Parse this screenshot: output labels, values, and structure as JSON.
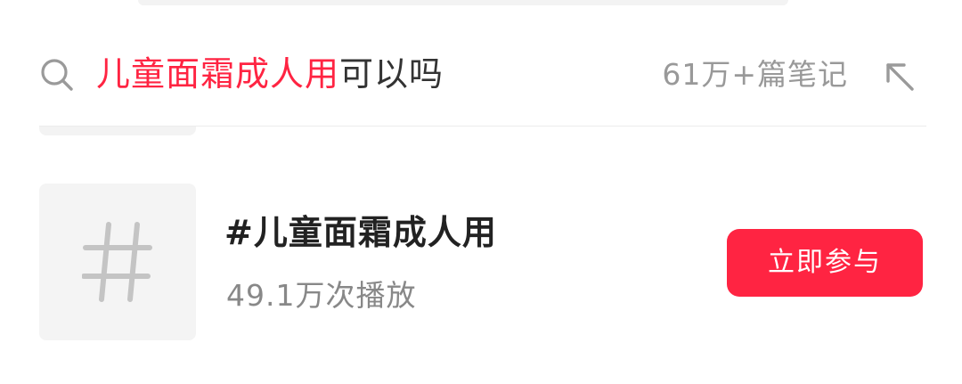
{
  "suggestion": {
    "highlight_text": "儿童面霜成人用",
    "rest_text": "可以吗",
    "note_count": "61万+篇笔记",
    "search_icon": "search-icon",
    "fill_icon": "arrow-up-left-icon"
  },
  "topic": {
    "thumb_icon": "hashtag-icon",
    "title": "#儿童面霜成人用",
    "views": "49.1万次播放",
    "join_label": "立即参与"
  },
  "colors": {
    "accent": "#ff2442",
    "text_primary": "#222222",
    "text_secondary": "#888888"
  }
}
